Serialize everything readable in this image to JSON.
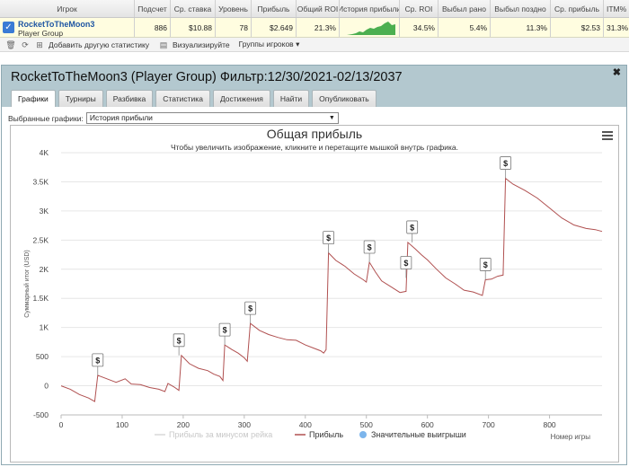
{
  "grid": {
    "columns": [
      "Игрок",
      "Подсчет",
      "Ср. ставка",
      "Уровень",
      "Прибыль",
      "Общий ROI",
      "История прибыли",
      "Ср. ROI",
      "Выбыл рано",
      "Выбыл поздно",
      "Ср. прибыль",
      "ITM%"
    ],
    "row": {
      "player": "RocketToTheMoon3",
      "group": "Player Group",
      "count": "886",
      "avg_stake": "$10.88",
      "level": "78",
      "profit": "$2.649",
      "total_roi": "21.3%",
      "avg_roi": "34.5%",
      "early_out": "5.4%",
      "late_out": "11.3%",
      "avg_profit": "$2.53",
      "itm": "31.3%"
    }
  },
  "toolbar": {
    "add_stats": "Добавить другую статистику",
    "visualize": "Визуализируйте",
    "player_groups": "Группы игроков"
  },
  "panel": {
    "title": "RocketToTheMoon3 (Player Group) Фильтр:12/30/2021-02/13/2037",
    "tabs": [
      "Графики",
      "Турниры",
      "Разбивка",
      "Статистика",
      "Достижения",
      "Найти",
      "Опубликовать"
    ],
    "active_tab": 0,
    "select_label": "Выбранные графики:",
    "select_value": "История прибыли"
  },
  "colors": {
    "profit_line": "#b05050",
    "rake_line": "#d8d8d8",
    "big_win_dot": "#7cb5ec",
    "panel_header": "#b3c8cf",
    "sparkline": "#4caf50"
  },
  "chart_data": {
    "type": "line",
    "title": "Общая прибыль",
    "subtitle": "Чтобы увеличить изображение, кликните и перетащите мышкой внутрь графика.",
    "xlabel": "Номер игры",
    "ylabel": "Суммарный итог (USD)",
    "xlim": [
      0,
      886
    ],
    "ylim": [
      -500,
      4000
    ],
    "x_ticks": [
      0,
      100,
      200,
      300,
      400,
      500,
      600,
      700,
      800
    ],
    "y_ticks": [
      -500,
      0,
      500,
      1000,
      1500,
      2000,
      2500,
      3000,
      3500,
      4000
    ],
    "y_tick_labels": [
      "-500",
      "0",
      "500",
      "1K",
      "1.5K",
      "2K",
      "2.5K",
      "3K",
      "3.5K",
      "4K"
    ],
    "legend": [
      "Прибыль за минусом рейка",
      "Прибыль",
      "Значительные выигрыши"
    ],
    "legend_position": "bottom",
    "big_win_marker": "$",
    "series": [
      {
        "name": "Прибыль",
        "points": [
          [
            0,
            0
          ],
          [
            15,
            -60
          ],
          [
            30,
            -150
          ],
          [
            45,
            -210
          ],
          [
            55,
            -270
          ],
          [
            60,
            180
          ],
          [
            75,
            120
          ],
          [
            90,
            60
          ],
          [
            105,
            120
          ],
          [
            115,
            30
          ],
          [
            130,
            20
          ],
          [
            145,
            -30
          ],
          [
            160,
            -60
          ],
          [
            170,
            -100
          ],
          [
            175,
            40
          ],
          [
            185,
            -20
          ],
          [
            193,
            -80
          ],
          [
            197,
            520
          ],
          [
            210,
            380
          ],
          [
            225,
            300
          ],
          [
            240,
            260
          ],
          [
            250,
            200
          ],
          [
            260,
            160
          ],
          [
            265,
            90
          ],
          [
            268,
            700
          ],
          [
            280,
            620
          ],
          [
            290,
            560
          ],
          [
            300,
            480
          ],
          [
            305,
            420
          ],
          [
            310,
            1070
          ],
          [
            325,
            950
          ],
          [
            340,
            880
          ],
          [
            355,
            830
          ],
          [
            370,
            790
          ],
          [
            385,
            780
          ],
          [
            400,
            700
          ],
          [
            415,
            640
          ],
          [
            425,
            600
          ],
          [
            430,
            560
          ],
          [
            434,
            620
          ],
          [
            438,
            2280
          ],
          [
            450,
            2150
          ],
          [
            465,
            2050
          ],
          [
            480,
            1920
          ],
          [
            495,
            1820
          ],
          [
            500,
            1780
          ],
          [
            505,
            2120
          ],
          [
            515,
            1950
          ],
          [
            525,
            1800
          ],
          [
            540,
            1700
          ],
          [
            555,
            1600
          ],
          [
            565,
            1620
          ],
          [
            568,
            2460
          ],
          [
            580,
            2350
          ],
          [
            590,
            2250
          ],
          [
            600,
            2160
          ],
          [
            615,
            2000
          ],
          [
            630,
            1850
          ],
          [
            645,
            1750
          ],
          [
            660,
            1640
          ],
          [
            675,
            1610
          ],
          [
            690,
            1550
          ],
          [
            695,
            1820
          ],
          [
            705,
            1830
          ],
          [
            715,
            1880
          ],
          [
            724,
            1900
          ],
          [
            728,
            3560
          ],
          [
            740,
            3460
          ],
          [
            760,
            3350
          ],
          [
            780,
            3220
          ],
          [
            800,
            3050
          ],
          [
            820,
            2880
          ],
          [
            840,
            2760
          ],
          [
            860,
            2700
          ],
          [
            875,
            2680
          ],
          [
            886,
            2649
          ]
        ]
      }
    ],
    "big_wins": [
      [
        60,
        180
      ],
      [
        193,
        520
      ],
      [
        268,
        700
      ],
      [
        310,
        1070
      ],
      [
        438,
        2280
      ],
      [
        505,
        2120
      ],
      [
        565,
        1850
      ],
      [
        575,
        2460
      ],
      [
        695,
        1820
      ],
      [
        728,
        3560
      ]
    ]
  }
}
